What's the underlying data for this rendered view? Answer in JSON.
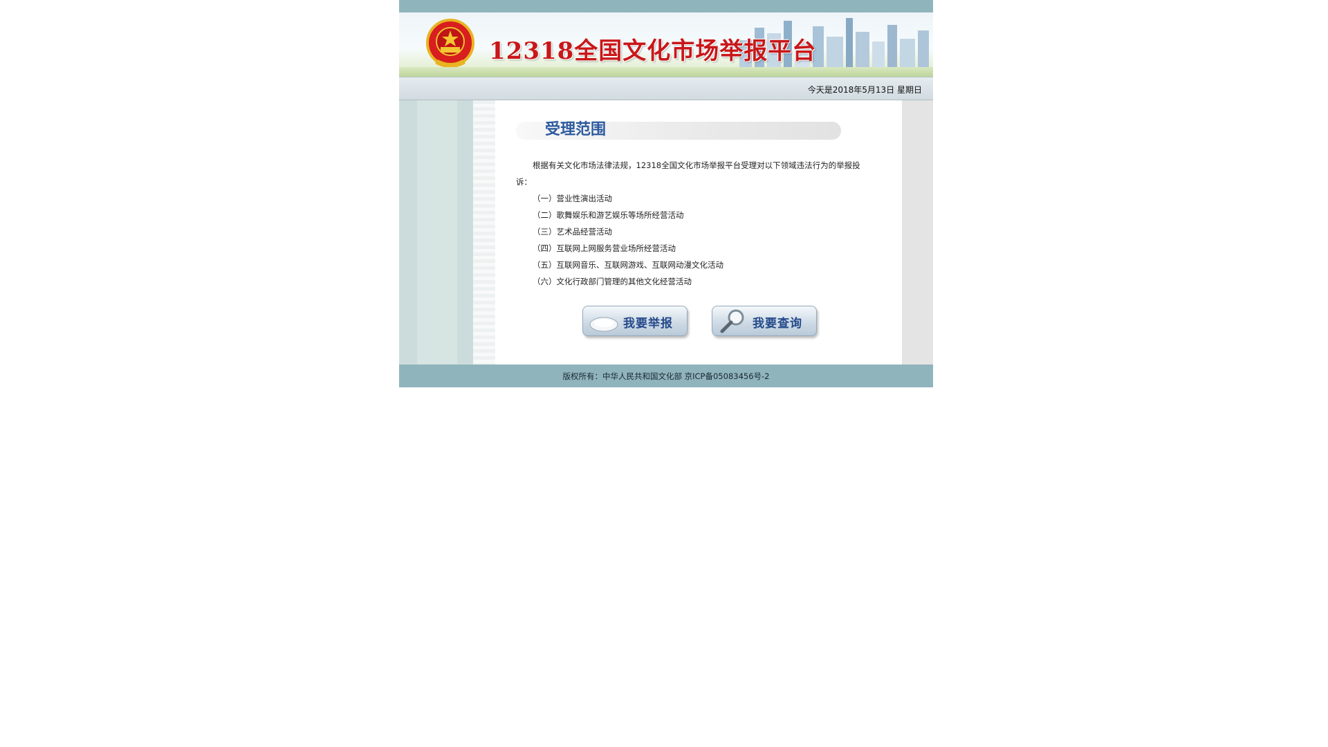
{
  "header": {
    "title": "12318全国文化市场举报平台",
    "date_text": "今天是2018年5月13日 星期日"
  },
  "section": {
    "heading": "受理范围",
    "intro": "根据有关文化市场法律法规，12318全国文化市场举报平台受理对以下领域违法行为的举报投诉：",
    "items": [
      "（一）营业性演出活动",
      "（二）歌舞娱乐和游艺娱乐等场所经营活动",
      "（三）艺术品经营活动",
      "（四）互联网上网服务营业场所经营活动",
      "（五）互联网音乐、互联网游戏、互联网动漫文化活动",
      "（六）文化行政部门管理的其他文化经营活动"
    ]
  },
  "buttons": {
    "report": "我要举报",
    "query": "我要查询"
  },
  "footer": {
    "copyright": "版权所有：中华人民共和国文化部  京ICP备05083456号-2"
  },
  "colors": {
    "bar": "#8fb4bc",
    "title_red": "#c8171a",
    "heading_blue": "#2c5a9e"
  },
  "icons": {
    "emblem": "national-emblem-icon",
    "report": "pen-icon",
    "query": "magnifier-icon"
  }
}
